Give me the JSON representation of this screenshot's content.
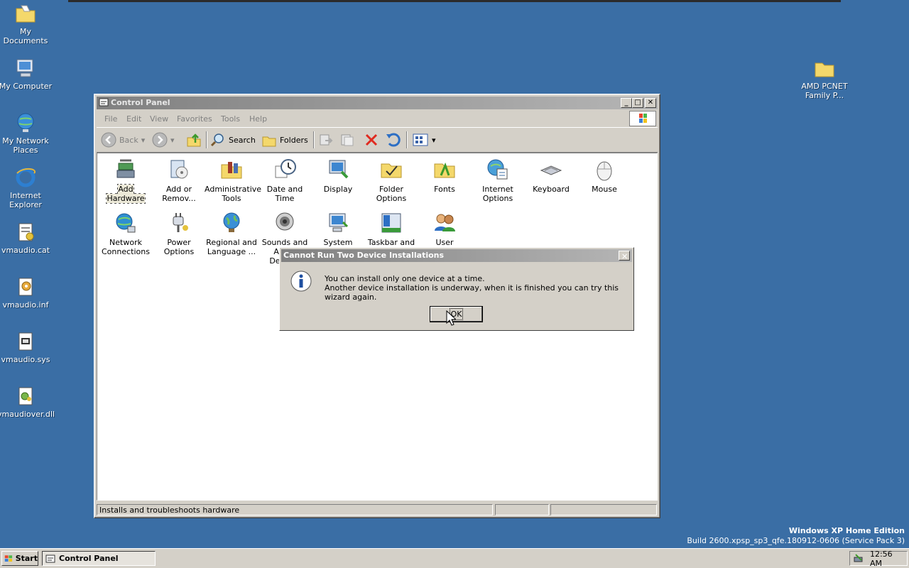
{
  "desktop": {
    "icons": [
      {
        "label": "My Documents"
      },
      {
        "label": "My Computer"
      },
      {
        "label": "My Network Places"
      },
      {
        "label": "Internet Explorer"
      },
      {
        "label": "vmaudio.cat"
      },
      {
        "label": "vmaudio.inf"
      },
      {
        "label": "vmaudio.sys"
      },
      {
        "label": "vmaudiover.dll"
      },
      {
        "label": "AMD PCNET Family P..."
      }
    ],
    "watermark_line1": "Windows XP Home Edition",
    "watermark_line2": "Build 2600.xpsp_sp3_qfe.180912-0606 (Service Pack 3)"
  },
  "window": {
    "title": "Control Panel",
    "menu": [
      "File",
      "Edit",
      "View",
      "Favorites",
      "Tools",
      "Help"
    ],
    "toolbar": {
      "back": "Back",
      "search": "Search",
      "folders": "Folders"
    },
    "items": [
      "Add Hardware",
      "Add or Remov...",
      "Administrative Tools",
      "Date and Time",
      "Display",
      "Folder Options",
      "Fonts",
      "Internet Options",
      "Keyboard",
      "Mouse",
      "Network Connections",
      "Power Options",
      "Regional and Language ...",
      "Sounds and Audio Devices",
      "System",
      "Taskbar and Start Menu",
      "User Accounts"
    ],
    "status": "Installs and troubleshoots hardware"
  },
  "dialog": {
    "title": "Cannot Run Two Device Installations",
    "line1": "You can install only one device at a time.",
    "line2": "Another device installation is underway, when it is finished you can try this wizard again.",
    "ok": "OK"
  },
  "taskbar": {
    "start": "Start",
    "task": "Control Panel",
    "clock": "12:56 AM"
  },
  "colors": {
    "desktop": "#3a6ea5",
    "chrome": "#d4d0c8"
  }
}
